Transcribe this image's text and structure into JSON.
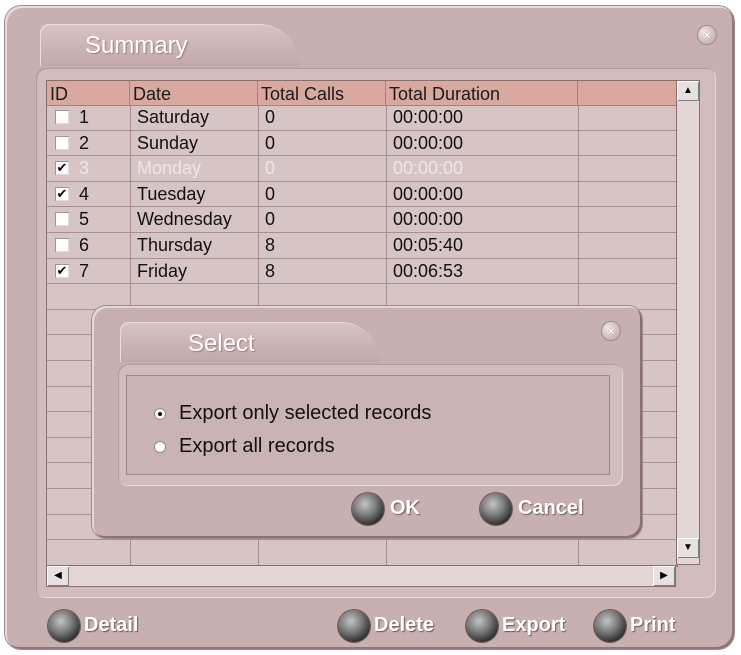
{
  "window": {
    "title": "Summary",
    "close_glyph": "×"
  },
  "table": {
    "headers": [
      "ID",
      "Date",
      "Total Calls",
      "Total Duration",
      ""
    ],
    "rows": [
      {
        "id": "1",
        "checked": false,
        "date": "Saturday",
        "calls": "0",
        "duration": "00:00:00",
        "dim": false
      },
      {
        "id": "2",
        "checked": false,
        "date": "Sunday",
        "calls": "0",
        "duration": "00:00:00",
        "dim": false
      },
      {
        "id": "3",
        "checked": true,
        "date": "Monday",
        "calls": "0",
        "duration": "00:00:00",
        "dim": true
      },
      {
        "id": "4",
        "checked": true,
        "date": "Tuesday",
        "calls": "0",
        "duration": "00:00:00",
        "dim": false
      },
      {
        "id": "5",
        "checked": false,
        "date": "Wednesday",
        "calls": "0",
        "duration": "00:00:00",
        "dim": false
      },
      {
        "id": "6",
        "checked": false,
        "date": "Thursday",
        "calls": "8",
        "duration": "00:05:40",
        "dim": false
      },
      {
        "id": "7",
        "checked": true,
        "date": "Friday",
        "calls": "8",
        "duration": "00:06:53",
        "dim": false
      }
    ],
    "check_glyph": "✔"
  },
  "scrollbars": {
    "up": "▲",
    "down": "▼",
    "left": "◀",
    "right": "▶"
  },
  "buttons": {
    "detail": "Detail",
    "delete": "Delete",
    "export": "Export",
    "print": "Print"
  },
  "dialog": {
    "title": "Select",
    "close_glyph": "×",
    "options": [
      {
        "label": "Export only selected records",
        "selected": true
      },
      {
        "label": "Export all records",
        "selected": false
      }
    ],
    "ok": "OK",
    "cancel": "Cancel"
  }
}
